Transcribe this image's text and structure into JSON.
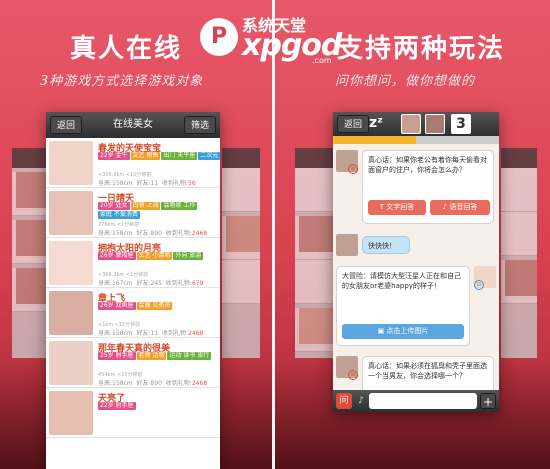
{
  "left_panel": {
    "headline": "真人在线",
    "subline": "3种游戏方式选择游戏对象",
    "list_screen": {
      "back_label": "返回",
      "title": "在线美女",
      "filter_label": "筛选",
      "profiles": [
        {
          "name": "春发的天使宝宝",
          "tags": [
            "22岁 金牛",
            "文艺 销售",
            "出门 天平座",
            "二次元"
          ],
          "distance": "<306.2km <10分钟前",
          "height": "158cm",
          "friends": "11",
          "gifts": "56"
        },
        {
          "name": "一日晴天",
          "tags": [
            "20岁 处女",
            "白领 上海",
            "会唱歌 工作",
            "家庭 不爱消费"
          ],
          "distance": "276km <1分钟前",
          "height": "158cm",
          "friends": "890",
          "gifts": "2468"
        },
        {
          "name": "拥抱太阳的月亮",
          "tags": [
            "26岁 摩羯座",
            "文艺 小清新",
            "外向 旅游"
          ],
          "distance": "<306.2km <1分钟前",
          "height": "167cm",
          "friends": "245",
          "gifts": "679"
        },
        {
          "name": "章上飞",
          "tags": [
            "26岁 双鱼座",
            "会展 公务员"
          ],
          "distance": "<1km <15分钟前",
          "height": "158cm",
          "friends": "11",
          "gifts": "2468"
        },
        {
          "name": "那年春天真的很美",
          "tags": [
            "25岁 射手座",
            "老师 话唠",
            "运动 读书 旅行"
          ],
          "distance": "454km <15分钟前",
          "height": "158cm",
          "friends": "890",
          "gifts": "2468"
        },
        {
          "name": "天亮了",
          "tags": [
            "22岁 射手座"
          ],
          "distance": "",
          "height": "",
          "friends": "",
          "gifts": ""
        }
      ],
      "labels": {
        "height": "身高:",
        "friends": "好友:",
        "gifts": "收到礼物:"
      }
    }
  },
  "logo": {
    "badge": "P",
    "cn": "系统天堂",
    "en": "xpgod",
    "com": ".com"
  },
  "right_panel": {
    "headline": "支持两种玩法",
    "subline": "问你想问，做你想做的",
    "chat_screen": {
      "back_label": "返回",
      "count": "3",
      "progress_fraction": 0.5,
      "messages": [
        {
          "text": "真心话：如果你老公有着你每天偷看对面窗户的住户，你将会怎么办？",
          "buttons": [
            "文字回答",
            "语音回答"
          ]
        },
        {
          "text": "快快快！"
        },
        {
          "text": "大冒险：请模仿大型汪星人正在和自己的女朋友or老婆happy的样子！",
          "buttons": [
            "点击上传图片"
          ]
        },
        {
          "text": "真心话：如果必须在狐臭和秃子里面选一个当男友，你会选择哪一个？"
        }
      ],
      "input": {
        "question_label": "问",
        "plus_label": "+",
        "placeholder": ""
      }
    }
  },
  "colors": {
    "panel_bg": "#e05060",
    "accent": "#e04a3a",
    "tag_age": "#e4508a",
    "tag_zodiac": "#f0a12a",
    "tag_job": "#6bb03b",
    "tag_hobby": "#3ba0d6"
  }
}
